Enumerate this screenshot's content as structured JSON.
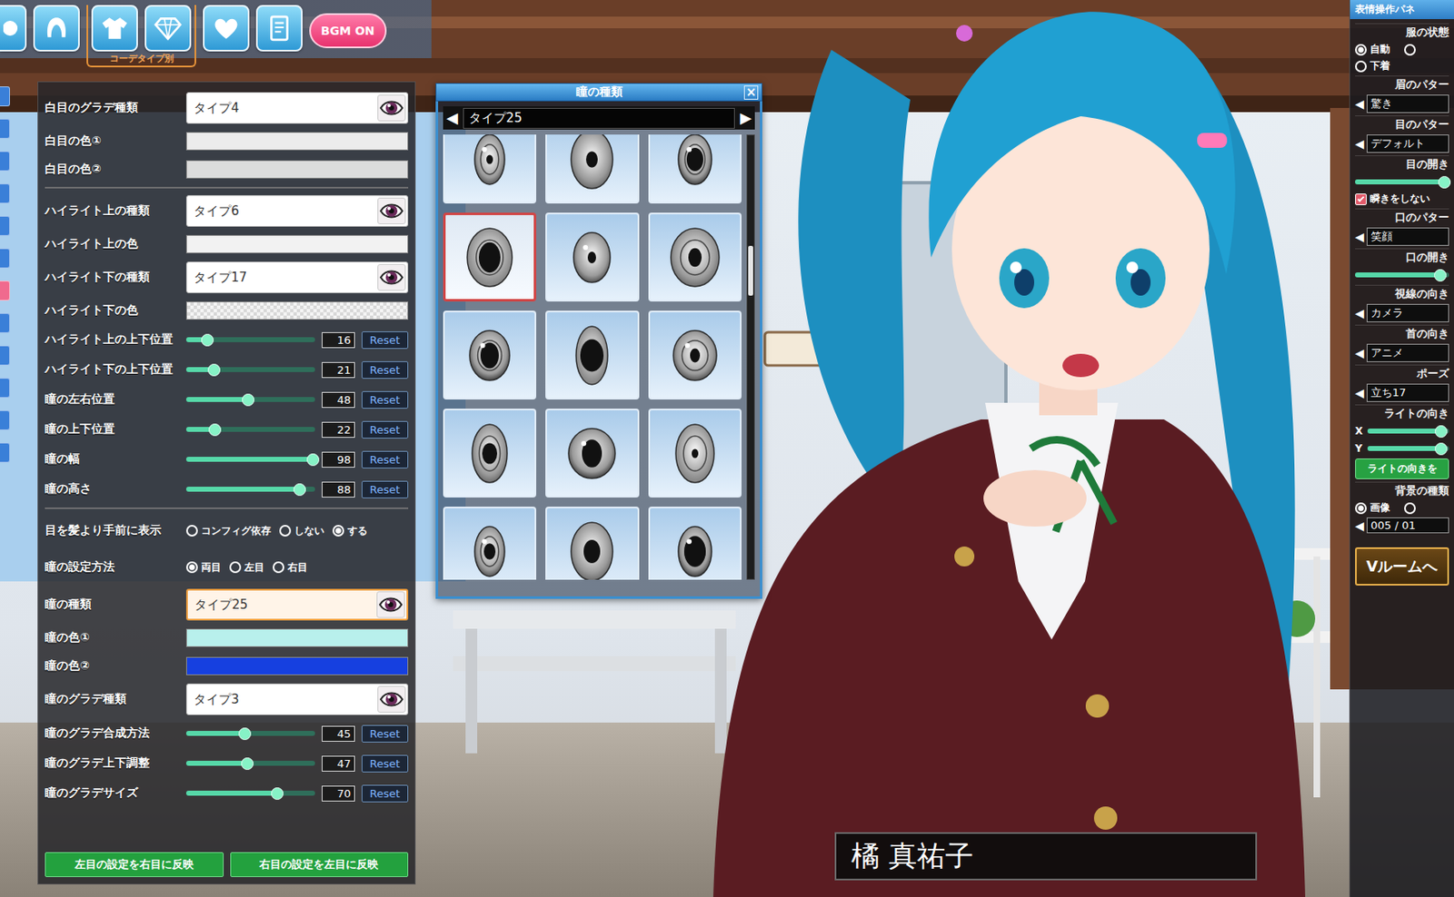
{
  "toolbar": {
    "buttons": [
      {
        "grouped": false
      },
      {
        "grouped": false
      },
      {
        "grouped": true
      },
      {
        "grouped": true
      },
      {
        "grouped": false
      },
      {
        "grouped": false
      }
    ],
    "group_label": "コーデタイプ別",
    "bgm": "BGM ON"
  },
  "side_tabs": [
    {
      "selected": false
    },
    {
      "selected": false
    },
    {
      "selected": false
    },
    {
      "selected": false
    },
    {
      "selected": false
    },
    {
      "selected": false
    },
    {
      "selected": true
    },
    {
      "selected": false
    },
    {
      "selected": false
    },
    {
      "selected": false
    },
    {
      "selected": false
    },
    {
      "selected": false
    }
  ],
  "settings": {
    "sections": [
      [
        {
          "kind": "select",
          "label": "白目のグラデ種類",
          "value": "タイプ4",
          "highlighted": false
        },
        {
          "kind": "color",
          "label": "白目の色①",
          "color": "#ececec",
          "transparent": false
        },
        {
          "kind": "color",
          "label": "白目の色②",
          "color": "#dcdcdc",
          "transparent": false
        }
      ],
      [
        {
          "kind": "select",
          "label": "ハイライト上の種類",
          "value": "タイプ6",
          "highlighted": false
        },
        {
          "kind": "color",
          "label": "ハイライト上の色",
          "color": "#f2f2f2",
          "transparent": false
        },
        {
          "kind": "select",
          "label": "ハイライト下の種類",
          "value": "タイプ17",
          "highlighted": false
        },
        {
          "kind": "color",
          "label": "ハイライト下の色",
          "color": "#f4f4f4",
          "transparent": true
        },
        {
          "kind": "slider",
          "label": "ハイライト上の上下位置",
          "level": 0.16,
          "reading": "16",
          "reset": "Reset"
        },
        {
          "kind": "slider",
          "label": "ハイライト下の上下位置",
          "level": 0.21,
          "reading": "21",
          "reset": "Reset"
        },
        {
          "kind": "slider",
          "label": "瞳の左右位置",
          "level": 0.48,
          "reading": "48",
          "reset": "Reset"
        },
        {
          "kind": "slider",
          "label": "瞳の上下位置",
          "level": 0.22,
          "reading": "22",
          "reset": "Reset"
        },
        {
          "kind": "slider",
          "label": "瞳の幅",
          "level": 0.98,
          "reading": "98",
          "reset": "Reset"
        },
        {
          "kind": "slider",
          "label": "瞳の高さ",
          "level": 0.88,
          "reading": "88",
          "reset": "Reset"
        }
      ],
      [
        {
          "kind": "radio",
          "label": "目を髪より手前に表示",
          "options": [
            {
              "label": "コンフィグ依存",
              "selected": false
            },
            {
              "label": "しない",
              "selected": false
            },
            {
              "label": "する",
              "selected": true
            }
          ]
        },
        {
          "kind": "radio",
          "label": "瞳の設定方法",
          "options": [
            {
              "label": "両目",
              "selected": true
            },
            {
              "label": "左目",
              "selected": false
            },
            {
              "label": "右目",
              "selected": false
            }
          ]
        },
        {
          "kind": "select",
          "label": "瞳の種類",
          "value": "タイプ25",
          "highlighted": true
        },
        {
          "kind": "color",
          "label": "瞳の色①",
          "color": "#b8f0ec",
          "transparent": false
        },
        {
          "kind": "color",
          "label": "瞳の色②",
          "color": "#1640e0",
          "transparent": false
        },
        {
          "kind": "select",
          "label": "瞳のグラデ種類",
          "value": "タイプ3",
          "highlighted": false
        },
        {
          "kind": "slider",
          "label": "瞳のグラデ合成方法",
          "level": 0.45,
          "reading": "45",
          "reset": "Reset"
        },
        {
          "kind": "slider",
          "label": "瞳のグラデ上下調整",
          "level": 0.47,
          "reading": "47",
          "reset": "Reset"
        },
        {
          "kind": "slider",
          "label": "瞳のグラデサイズ",
          "level": 0.7,
          "reading": "70",
          "reset": "Reset"
        }
      ]
    ],
    "buttons": [
      "左目の設定を右目に反映",
      "右目の設定を左目に反映"
    ]
  },
  "picker": {
    "title": "瞳の種類",
    "close": "×",
    "prev": "◀",
    "next": "▶",
    "value": "タイプ25",
    "scroll_level": 0.28,
    "thumbnails": [
      {
        "selected": false
      },
      {
        "selected": false
      },
      {
        "selected": false
      },
      {
        "selected": true
      },
      {
        "selected": false
      },
      {
        "selected": false
      },
      {
        "selected": false
      },
      {
        "selected": false
      },
      {
        "selected": false
      },
      {
        "selected": false
      },
      {
        "selected": false
      },
      {
        "selected": false
      },
      {
        "selected": false
      },
      {
        "selected": false
      },
      {
        "selected": false
      }
    ]
  },
  "right_panel": {
    "title": "表情操作パネ",
    "items": [
      {
        "kind": "heading",
        "text": "服の状態"
      },
      {
        "kind": "radios",
        "options": [
          {
            "label": "自動",
            "selected": true
          },
          {
            "selected": false
          },
          {
            "label": "下着",
            "selected": false
          }
        ]
      },
      {
        "kind": "heading",
        "text": "眉のパター"
      },
      {
        "kind": "selector",
        "arrow": "◀",
        "value": "驚き"
      },
      {
        "kind": "heading",
        "text": "目のパター"
      },
      {
        "kind": "selector",
        "arrow": "◀",
        "value": "デフォルト"
      },
      {
        "kind": "heading",
        "text": "目の開き"
      },
      {
        "kind": "slider",
        "level": 0.95
      },
      {
        "kind": "checkbox",
        "text": "瞬きをしない",
        "checked": true
      },
      {
        "kind": "heading",
        "text": "口のパター"
      },
      {
        "kind": "selector",
        "arrow": "◀",
        "value": "笑顔"
      },
      {
        "kind": "heading",
        "text": "口の開き"
      },
      {
        "kind": "slider",
        "level": 0.9
      },
      {
        "kind": "heading",
        "text": "視線の向き"
      },
      {
        "kind": "selector",
        "arrow": "◀",
        "value": "カメラ"
      },
      {
        "kind": "heading",
        "text": "首の向き"
      },
      {
        "kind": "selector",
        "arrow": "◀",
        "value": "アニメ"
      },
      {
        "kind": "heading",
        "text": "ポーズ"
      },
      {
        "kind": "selector",
        "arrow": "◀",
        "value": "立ち17"
      },
      {
        "kind": "heading",
        "text": "ライトの向き"
      },
      {
        "kind": "slider",
        "axis": "X",
        "level": 0.9
      },
      {
        "kind": "slider",
        "axis": "Y",
        "level": 0.9
      },
      {
        "kind": "button",
        "text": "ライトの向きを",
        "big": false
      },
      {
        "kind": "heading",
        "text": "背景の種類"
      },
      {
        "kind": "radios",
        "options": [
          {
            "label": "画像",
            "selected": true
          },
          {
            "selected": false
          }
        ]
      },
      {
        "kind": "selector",
        "arrow": "◀",
        "value": "005 / 01"
      },
      {
        "kind": "button",
        "text": "Vルームへ",
        "big": true
      }
    ]
  },
  "nameplate": {
    "name": "橘 真祐子"
  }
}
